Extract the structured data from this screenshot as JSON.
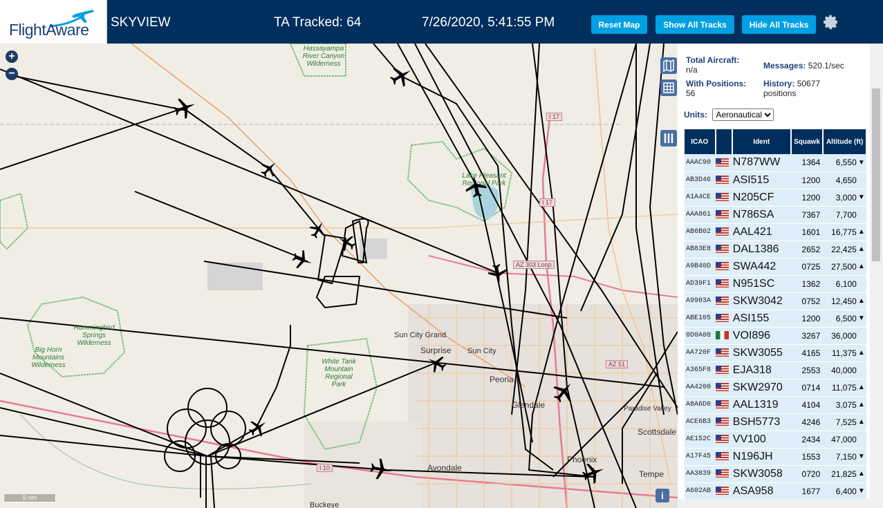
{
  "header": {
    "logo_text": "FlightAware",
    "app_title": "SKYVIEW",
    "tracked": "TA Tracked: 64",
    "datetime": "7/26/2020, 5:41:55 PM",
    "buttons": {
      "reset": "Reset Map",
      "show": "Show All Tracks",
      "hide": "Hide All Tracks"
    },
    "gear_icon": "gear-icon"
  },
  "map": {
    "zoom_in": "+",
    "zoom_out": "−",
    "scale": "5 nm",
    "info_icon": "i",
    "labels": {
      "hassayampa": "Hassayampa River Canyon Wilderness",
      "lake": "Lake Pleasant Regional Park",
      "hummingbird": "Hummingbird Springs Wilderness",
      "bighorn": "Big Horn Mountains Wilderness",
      "whitetank": "White Tank Mountain Regional Park",
      "suncitygrand": "Sun City Grand",
      "surprise": "Surprise",
      "suncity": "Sun City",
      "peoria": "Peoria",
      "glendale": "Glendale",
      "paradise": "Paradise Valley",
      "scottsdale": "Scottsdale",
      "phoenix": "Phoenix",
      "tempe": "Tempe",
      "avondale": "Avondale",
      "buckeye": "Buckeye"
    },
    "shields": {
      "i17a": "I 17",
      "i17b": "I 17",
      "az303": "AZ 303 Loop",
      "az51": "AZ 51",
      "i10": "I 10"
    }
  },
  "panel": {
    "total_aircraft_label": "Total Aircraft:",
    "total_aircraft_value": "n/a",
    "messages_label": "Messages:",
    "messages_value": "520.1/sec",
    "with_positions_label": "With Positions:",
    "with_positions_value": "56",
    "history_label": "History:",
    "history_value": "50677",
    "history_unit": "positions",
    "units_label": "Units:",
    "units_value": "Aeronautical",
    "columns": [
      "ICAO",
      "",
      "Ident",
      "Squawk",
      "Altitude (ft)"
    ],
    "rows": [
      {
        "icao": "AAAC90",
        "flag": "us",
        "ident": "N787WW",
        "squawk": "1364",
        "alt": "6,550",
        "trend": "▼"
      },
      {
        "icao": "AB3D46",
        "flag": "us",
        "ident": "ASI515",
        "squawk": "1200",
        "alt": "4,650",
        "trend": ""
      },
      {
        "icao": "A1A4CE",
        "flag": "us",
        "ident": "N205CF",
        "squawk": "1200",
        "alt": "3,000",
        "trend": "▼"
      },
      {
        "icao": "AAA861",
        "flag": "us",
        "ident": "N786SA",
        "squawk": "7367",
        "alt": "7,700",
        "trend": ""
      },
      {
        "icao": "AB6B02",
        "flag": "us",
        "ident": "AAL421",
        "squawk": "1601",
        "alt": "16,775",
        "trend": "▲"
      },
      {
        "icao": "AB83E8",
        "flag": "us",
        "ident": "DAL1386",
        "squawk": "2652",
        "alt": "22,425",
        "trend": "▲"
      },
      {
        "icao": "A9B40D",
        "flag": "us",
        "ident": "SWA442",
        "squawk": "0725",
        "alt": "27,500",
        "trend": "▲"
      },
      {
        "icao": "AD39F1",
        "flag": "us",
        "ident": "N951SC",
        "squawk": "1362",
        "alt": "6,100",
        "trend": ""
      },
      {
        "icao": "A9903A",
        "flag": "us",
        "ident": "SKW3042",
        "squawk": "0752",
        "alt": "12,450",
        "trend": "▲"
      },
      {
        "icao": "ABE105",
        "flag": "us",
        "ident": "ASI155",
        "squawk": "1200",
        "alt": "6,500",
        "trend": "▼"
      },
      {
        "icao": "0D0A08",
        "flag": "mx",
        "ident": "VOI896",
        "squawk": "3267",
        "alt": "36,000",
        "trend": ""
      },
      {
        "icao": "AA720F",
        "flag": "us",
        "ident": "SKW3055",
        "squawk": "4165",
        "alt": "11,375",
        "trend": "▲"
      },
      {
        "icao": "A365F8",
        "flag": "us",
        "ident": "EJA318",
        "squawk": "2553",
        "alt": "40,000",
        "trend": ""
      },
      {
        "icao": "AA4200",
        "flag": "us",
        "ident": "SKW2970",
        "squawk": "0714",
        "alt": "11,075",
        "trend": "▲"
      },
      {
        "icao": "A8A6D0",
        "flag": "us",
        "ident": "AAL1319",
        "squawk": "4104",
        "alt": "3,075",
        "trend": "▲"
      },
      {
        "icao": "ACE6B3",
        "flag": "us",
        "ident": "BSH5773",
        "squawk": "4246",
        "alt": "7,525",
        "trend": "▲"
      },
      {
        "icao": "AE152C",
        "flag": "us",
        "ident": "VV100",
        "squawk": "2434",
        "alt": "47,000",
        "trend": ""
      },
      {
        "icao": "A17F45",
        "flag": "us",
        "ident": "N196JH",
        "squawk": "1553",
        "alt": "7,150",
        "trend": "▼"
      },
      {
        "icao": "AA3839",
        "flag": "us",
        "ident": "SKW3058",
        "squawk": "0720",
        "alt": "21,825",
        "trend": "▲"
      },
      {
        "icao": "A602AB",
        "flag": "us",
        "ident": "ASA958",
        "squawk": "1677",
        "alt": "6,400",
        "trend": "▼"
      }
    ]
  }
}
